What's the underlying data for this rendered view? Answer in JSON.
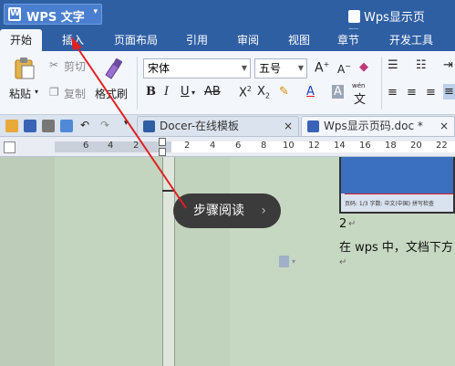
{
  "app": {
    "name": "WPS 文字",
    "logo": "W",
    "document_title": "Wps显示页码.doc"
  },
  "menu": {
    "tabs": [
      "开始",
      "插入",
      "页面布局",
      "引用",
      "审阅",
      "视图",
      "章节",
      "开发工具"
    ]
  },
  "ribbon": {
    "paste": "粘贴",
    "cut": "剪切",
    "copy": "复制",
    "format_painter": "格式刷",
    "font_name": "宋体",
    "font_size": "五号",
    "wen_label": "wén",
    "wen_char": "文"
  },
  "doc_tabs": [
    {
      "label": "Docer-在线模板",
      "close": "×"
    },
    {
      "label": "Wps显示页码.doc *",
      "close": "×"
    }
  ],
  "ruler": {
    "numbers": [
      "6",
      "4",
      "2",
      "2",
      "4",
      "6",
      "8",
      "10",
      "12",
      "14",
      "16",
      "18",
      "20",
      "22"
    ]
  },
  "document": {
    "line1": "2",
    "line2": "在 wps 中，文档下方",
    "thumbnail_text": "页码: 1/3   字数: 中文(中国)   拼写检查"
  },
  "tooltip": {
    "label": "步骤阅读",
    "chevron": "›"
  },
  "colors": {
    "titlebar": "#2f5fa3",
    "ribbon": "#f3f6fb",
    "annotation_arrow": "#e02020",
    "page_bg": "#c8d9c4"
  },
  "icons": [
    "wps-logo-icon",
    "document-icon",
    "paste-icon",
    "scissors-icon",
    "copy-icon",
    "brush-icon",
    "folder-icon",
    "save-icon",
    "print-icon",
    "undo-icon",
    "redo-icon",
    "close-icon"
  ]
}
